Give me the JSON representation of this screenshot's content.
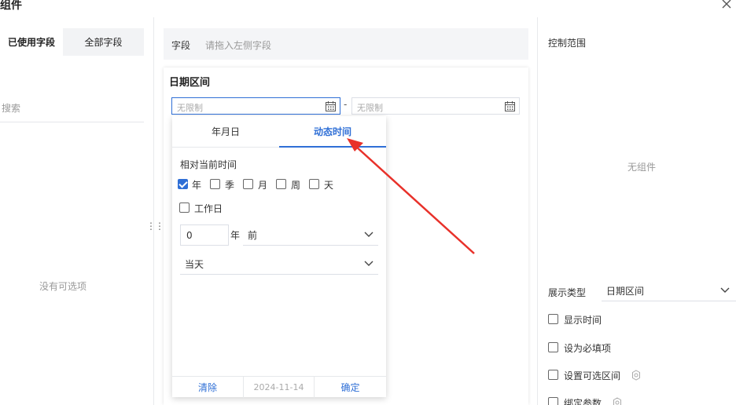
{
  "header": {
    "title": "组件",
    "close_icon": "close-icon"
  },
  "left_panel": {
    "tabs": [
      {
        "label": "已使用字段",
        "active": true
      },
      {
        "label": "全部字段",
        "active": false
      }
    ],
    "search_placeholder": "搜索",
    "empty_text": "没有可选项"
  },
  "field_bar": {
    "label": "字段",
    "hint": "请拖入左侧字段"
  },
  "card": {
    "title": "日期区间",
    "start_placeholder": "无限制",
    "separator": "-",
    "end_placeholder": "无限制",
    "calendar_icon": "calendar-icon"
  },
  "picker": {
    "tabs": [
      {
        "label": "年月日",
        "active": false
      },
      {
        "label": "动态时间",
        "active": true
      }
    ],
    "relative_label": "相对当前时间",
    "units": [
      {
        "label": "年",
        "checked": true
      },
      {
        "label": "季",
        "checked": false
      },
      {
        "label": "月",
        "checked": false
      },
      {
        "label": "周",
        "checked": false
      },
      {
        "label": "天",
        "checked": false
      }
    ],
    "workday": {
      "label": "工作日",
      "checked": false
    },
    "offset_value": "0",
    "offset_unit": "年",
    "direction": "前",
    "anchor": "当天",
    "footer": {
      "clear": "清除",
      "date": "2024-11-14",
      "confirm": "确定"
    }
  },
  "right_panel": {
    "control_scope_label": "控制范围",
    "no_component_text": "无组件",
    "display_type_label": "展示类型",
    "display_type_value": "日期区间",
    "options": [
      {
        "label": "显示时间",
        "checked": false,
        "gear": false
      },
      {
        "label": "设为必填项",
        "checked": false,
        "gear": false
      },
      {
        "label": "设置可选区间",
        "checked": false,
        "gear": true
      },
      {
        "label": "绑定参数",
        "checked": false,
        "gear": true
      }
    ]
  },
  "colors": {
    "accent": "#2f6fd6",
    "arrow": "#e8312a",
    "muted": "#999999"
  }
}
